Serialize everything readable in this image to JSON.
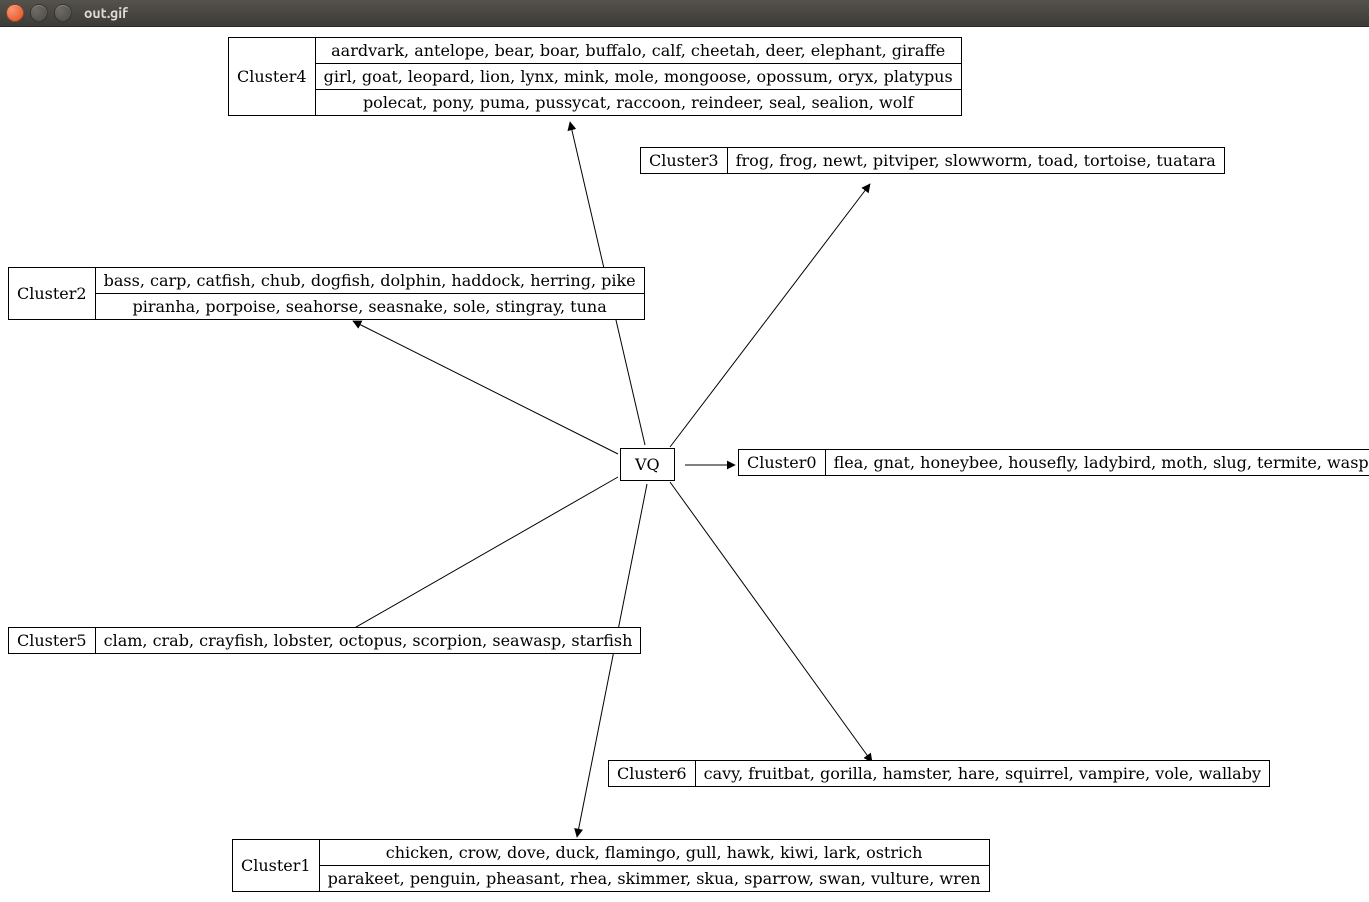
{
  "window": {
    "title": "out.gif"
  },
  "center": {
    "label": "VQ"
  },
  "clusters": {
    "c0": {
      "label": "Cluster0",
      "rows": [
        "flea, gnat, honeybee, housefly, ladybird, moth, slug, termite, wasp, worm"
      ]
    },
    "c1": {
      "label": "Cluster1",
      "rows": [
        "chicken, crow, dove, duck, flamingo, gull, hawk, kiwi, lark, ostrich",
        "parakeet, penguin, pheasant, rhea, skimmer, skua, sparrow, swan, vulture, wren"
      ]
    },
    "c2": {
      "label": "Cluster2",
      "rows": [
        "bass, carp, catfish, chub, dogfish, dolphin, haddock, herring, pike",
        "piranha, porpoise, seahorse, seasnake, sole, stingray, tuna"
      ]
    },
    "c3": {
      "label": "Cluster3",
      "rows": [
        "frog, frog, newt, pitviper, slowworm, toad, tortoise, tuatara"
      ]
    },
    "c4": {
      "label": "Cluster4",
      "rows": [
        "aardvark, antelope, bear, boar, buffalo, calf, cheetah, deer, elephant, giraffe",
        "girl, goat, leopard, lion, lynx, mink, mole, mongoose, opossum, oryx, platypus",
        "polecat, pony, puma, pussycat, raccoon, reindeer, seal, sealion, wolf"
      ]
    },
    "c5": {
      "label": "Cluster5",
      "rows": [
        "clam, crab, crayfish, lobster, octopus, scorpion, seawasp, starfish"
      ]
    },
    "c6": {
      "label": "Cluster6",
      "rows": [
        "cavy, fruitbat, gorilla, hamster, hare, squirrel, vampire, vole, wallaby"
      ]
    }
  }
}
